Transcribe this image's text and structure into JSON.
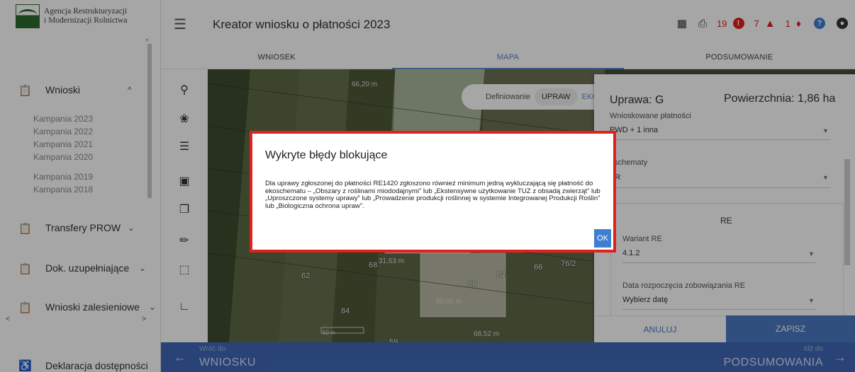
{
  "sidebar": {
    "logo_line1": "Agencja Restrukturyzacji",
    "logo_line2": "i Modernizacji Rolnictwa",
    "sections": [
      {
        "label": "Wnioski",
        "icon": "clipboard-icon",
        "chevron": "^"
      },
      {
        "label": "Transfery PROW",
        "icon": "clipboard-icon",
        "chevron": "⌄"
      },
      {
        "label": "Dok. uzupełniające",
        "icon": "clipboard-icon",
        "chevron": "⌄"
      },
      {
        "label": "Wnioski zalesieniowe",
        "icon": "clipboard-icon",
        "chevron": "⌄"
      }
    ],
    "campaigns": [
      "Kampania 2023",
      "Kampania 2022",
      "Kampania 2021",
      "Kampania 2020",
      "Kampania 2019",
      "Kampania 2018"
    ],
    "accessibility": "Deklaracja dostępności"
  },
  "header": {
    "title": "Kreator wniosku o płatności 2023",
    "count_errors": "19",
    "count_warnings": "7",
    "count_alerts": "1",
    "colors": {
      "error": "#e0211c",
      "warning": "#e0211c",
      "help": "#3f7fd1"
    }
  },
  "tabs": [
    {
      "label": "WNIOSEK"
    },
    {
      "label": "MAPA"
    },
    {
      "label": "PODSUMOWANIE"
    }
  ],
  "map": {
    "def_label": "Definiowanie",
    "def_uprawa": "UPRAW",
    "def_eko": "EKO",
    "area_labels": [
      "66,20 m",
      "31,63 m",
      "90,00 m",
      "68,52 m"
    ],
    "parcel_labels": [
      "62",
      "68",
      "86",
      "67",
      "66",
      "76/2",
      "84",
      "59"
    ],
    "scale_label": "50 m"
  },
  "panel": {
    "title_left": "Uprawa: G",
    "title_right": "Powierzchnia: 1,86 ha",
    "field1_label": "Wnioskowane płatności",
    "field1_value": "PWD + 1 inna",
    "field2_label": "oschematy",
    "field2_value": "PR",
    "re_title": "RE",
    "field3_label": "Wariant RE",
    "field3_value": "4.1.2",
    "field4_label": "Data rozpoczęcia zobowiązania RE",
    "field4_value": "Wybierz datę",
    "cancel": "ANULUJ",
    "save": "ZAPISZ"
  },
  "bottom": {
    "prev_small": "Wróć do",
    "prev_big": "WNIOSKU",
    "next_small": "Idź do",
    "next_big": "PODSUMOWANIA"
  },
  "dialog": {
    "title": "Wykryte błędy blokujące",
    "body": "Dla uprawy zgłoszonej do płatności RE1420 zgłoszono również minimum jedną wykluczającą się płatność do ekoschematu – „Obszary z roślinami miododajnymi” lub „Ekstensywne użytkowanie TUZ z obsadą zwierząt” lub „Uproszczone systemy uprawy” lub „Prowadzenie produkcji roślinnej w systemie Integrowanej Produkcji Roślin” lub „Biologiczna ochrona upraw”.",
    "ok": "OK",
    "border_color": "#e0211c"
  }
}
